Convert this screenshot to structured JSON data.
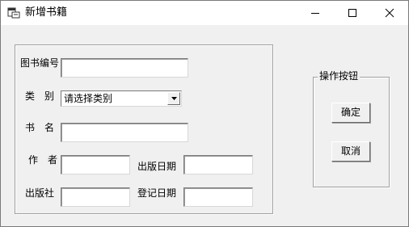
{
  "window": {
    "title": "新增书籍"
  },
  "form": {
    "book_id_label": "图书编号",
    "category_label": "类　别",
    "category_value": "请选择类别",
    "title_label": "书　名",
    "author_label": "作　者",
    "pub_date_label": "出版日期",
    "publisher_label": "出版社",
    "reg_date_label": "登记日期"
  },
  "actions": {
    "legend": "操作按钮",
    "confirm_label": "确定",
    "cancel_label": "取消"
  }
}
